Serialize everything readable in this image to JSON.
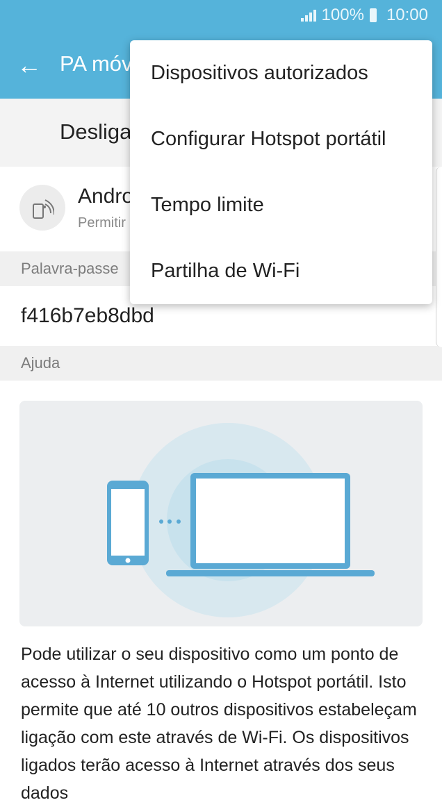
{
  "status_bar": {
    "battery": "100%",
    "time": "10:00"
  },
  "app_bar": {
    "title": "PA móvel"
  },
  "switch": {
    "label": "Desligado"
  },
  "device": {
    "name": "Android",
    "subtitle": "Permitir"
  },
  "password_section": {
    "label": "Palavra-passe",
    "value": "f416b7eb8dbd"
  },
  "help_section": {
    "label": "Ajuda",
    "text": "Pode utilizar o seu dispositivo como um ponto de acesso à Internet utilizando o Hotspot portátil. Isto permite que até 10 outros dispositivos estabeleçam ligação com este através de Wi-Fi. Os dispositivos ligados terão acesso à Internet através dos seus dados"
  },
  "menu": {
    "items": [
      {
        "label": "Dispositivos autorizados"
      },
      {
        "label": "Configurar Hotspot portátil"
      },
      {
        "label": "Tempo limite"
      },
      {
        "label": "Partilha de Wi-Fi"
      }
    ]
  },
  "colors": {
    "accent": "#55b3da",
    "illustration_bg": "#eceef0"
  },
  "icons": [
    "signal-icon",
    "battery-icon",
    "back-arrow-icon",
    "device-icon",
    "phone-icon",
    "laptop-icon"
  ]
}
